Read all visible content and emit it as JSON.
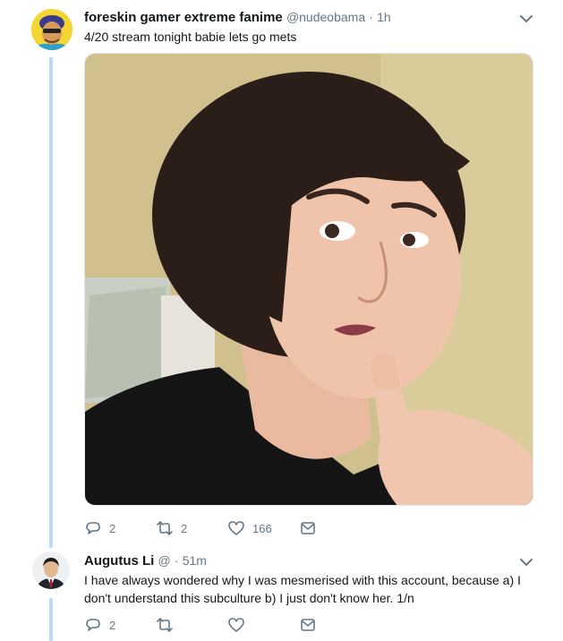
{
  "tweet1": {
    "display_name": "foreskin gamer extreme fanime",
    "handle": "@nudeobama",
    "separator": "·",
    "time": "1h",
    "text": "4/20 stream tonight babie lets go mets",
    "media": {
      "type": "photo"
    },
    "actions": {
      "reply_count": "2",
      "retweet_count": "2",
      "like_count": "166"
    }
  },
  "tweet2": {
    "display_name": "Augutus Li",
    "handle": "@",
    "separator": "·",
    "time": "51m",
    "text_line1": "I have always wondered why I was mesmerised with this account,  because a) I",
    "text_line2": "don't understand this subculture  b) I just don't know her. 1/n",
    "actions": {
      "reply_count": "2",
      "retweet_count": "",
      "like_count": ""
    }
  },
  "colors": {
    "accent": "#1da1f2",
    "thread_line": "#b6dcf5",
    "secondary_text": "#657786"
  },
  "icons": [
    "reply-icon",
    "retweet-icon",
    "heart-icon",
    "direct-message-icon",
    "chevron-down-icon"
  ]
}
